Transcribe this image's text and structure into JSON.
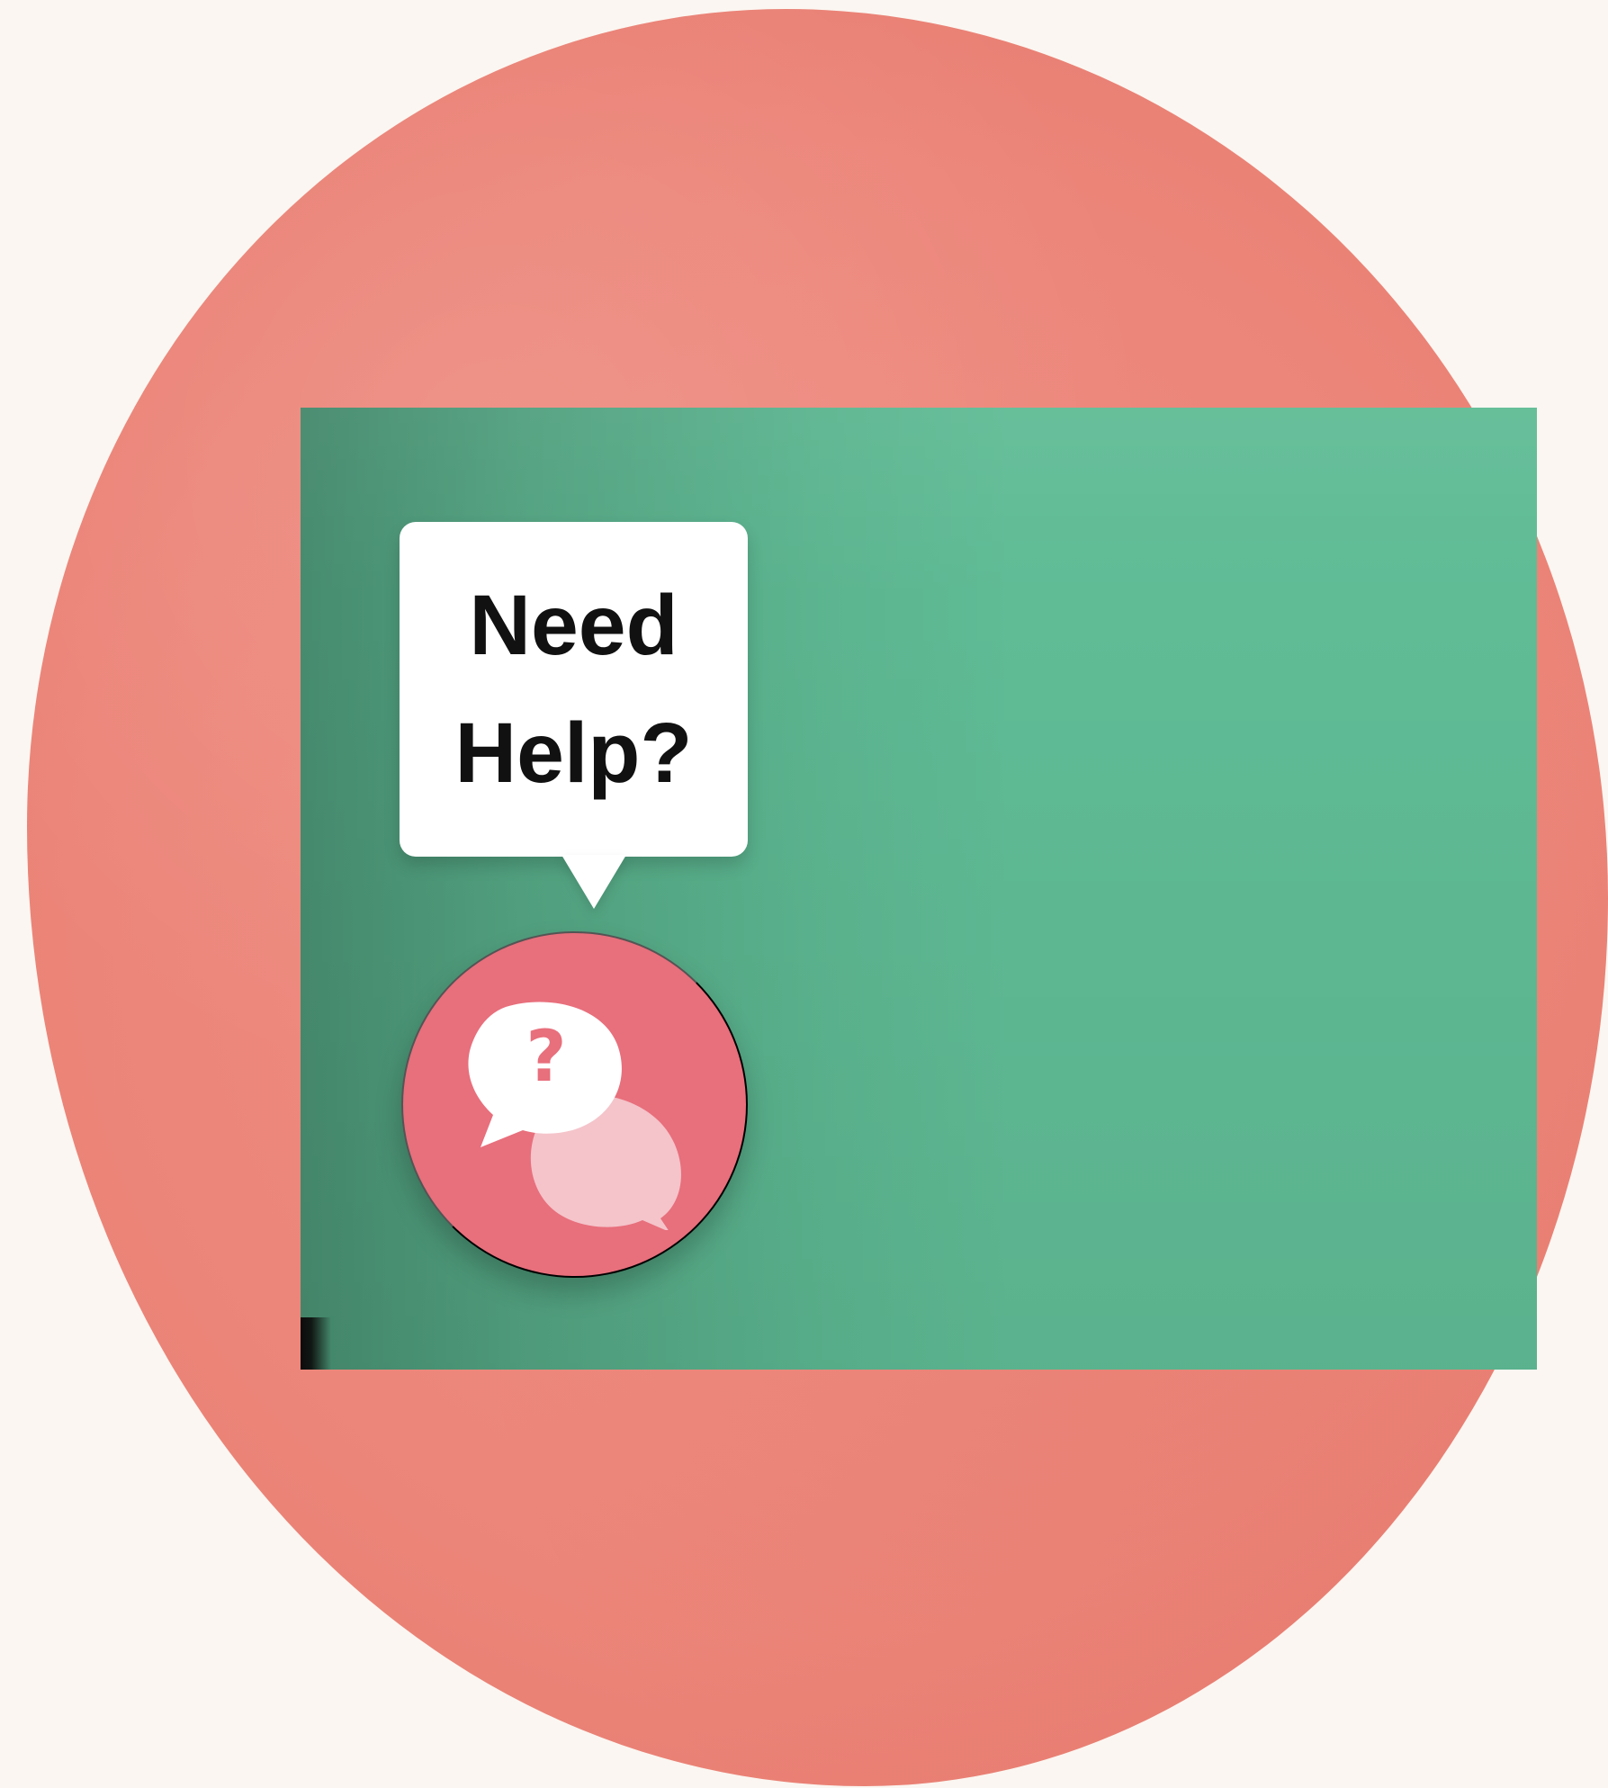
{
  "colors": {
    "background": "#fbf6f1",
    "blob": "#ec8579",
    "panel": "#5fbc95",
    "tooltip": "#ffffff",
    "button": "#e86f7c"
  },
  "tooltip": {
    "text": "Need\nHelp?"
  },
  "help_button": {
    "icon": "speech-bubbles-question-icon"
  }
}
